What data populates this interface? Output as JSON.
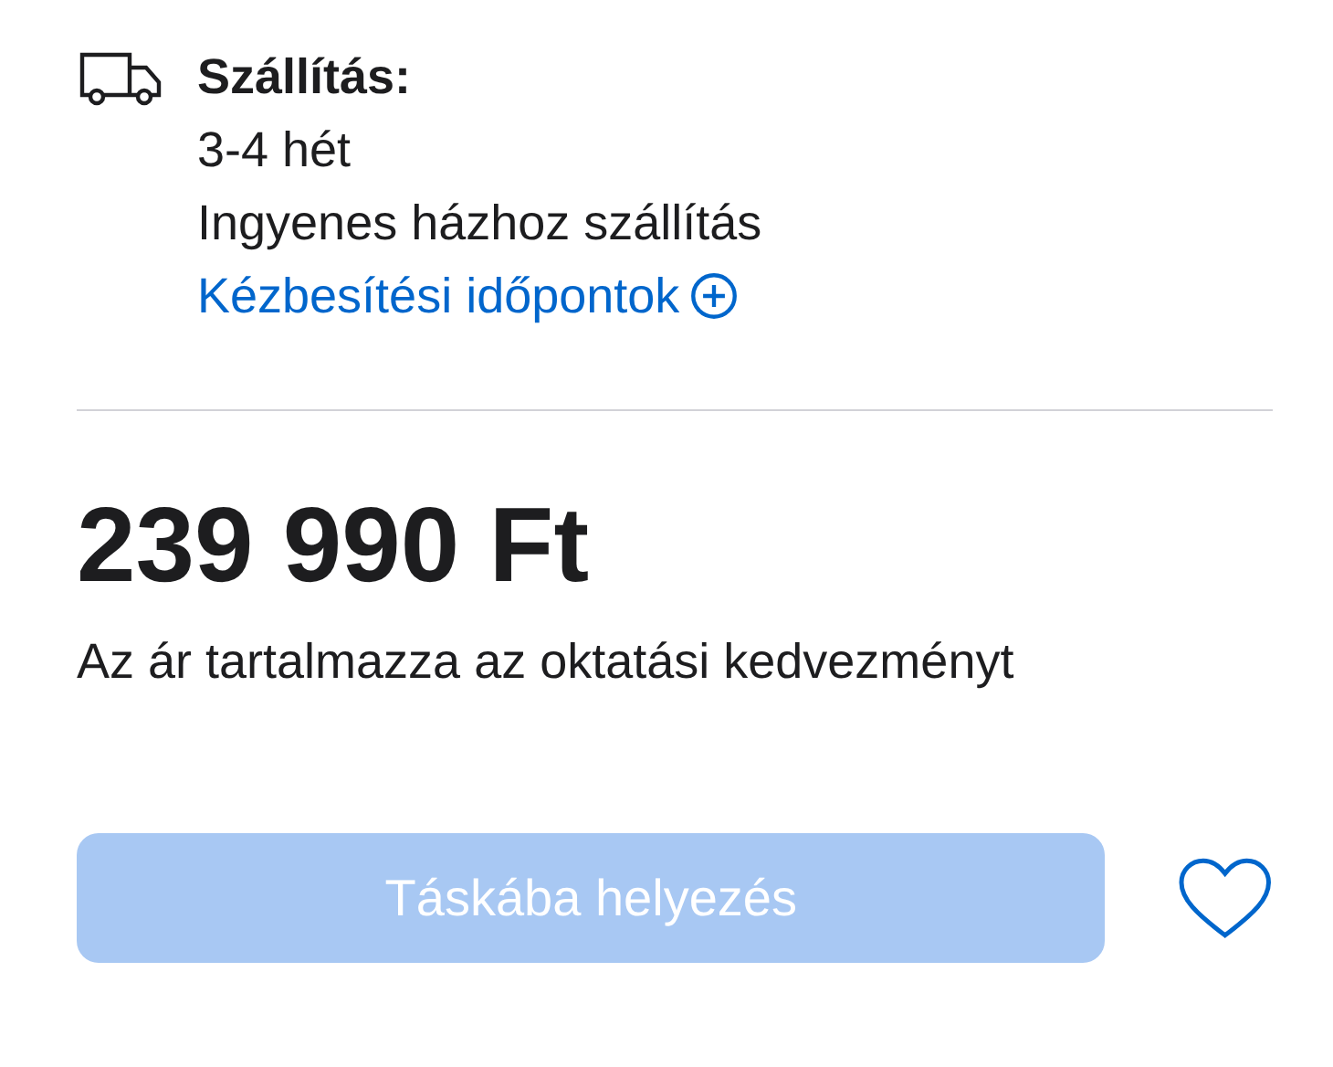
{
  "delivery": {
    "title": "Szállítás:",
    "lines": [
      "3-4 hét",
      "Ingyenes házhoz szállítás"
    ],
    "link": "Kézbesítési időpontok"
  },
  "price": "239 990 Ft",
  "note": "Az ár tartalmazza az oktatási kedvezményt",
  "add_button": {
    "label": "Táskába helyezés",
    "disabled": true
  }
}
